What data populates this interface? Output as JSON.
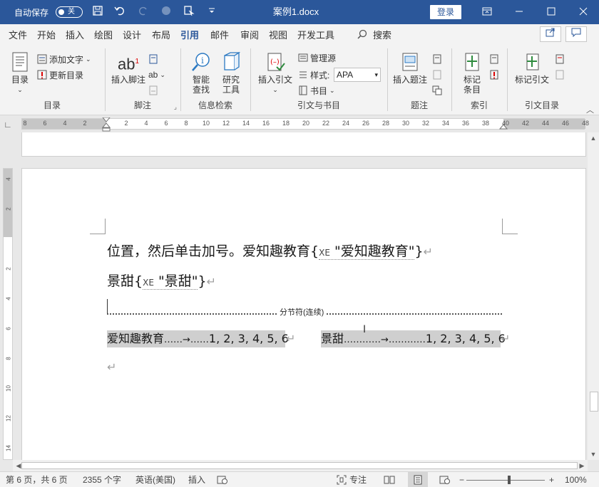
{
  "titlebar": {
    "autosave_label": "自动保存",
    "autosave_state": "关",
    "doc_title": "案例1.docx",
    "login": "登录",
    "icons": [
      "save-icon",
      "undo-icon",
      "redo-icon",
      "circle-icon",
      "touch-mode-icon",
      "customize-qat-icon"
    ]
  },
  "menu": {
    "tabs": [
      "文件",
      "开始",
      "插入",
      "绘图",
      "设计",
      "布局",
      "引用",
      "邮件",
      "审阅",
      "视图",
      "开发工具"
    ],
    "active": "引用",
    "search": "搜索"
  },
  "ribbon": {
    "toc": {
      "btn": "目录",
      "add_text": "添加文字",
      "update": "更新目录",
      "label": "目录"
    },
    "footnote": {
      "insert": "插入脚注",
      "label": "脚注",
      "icon_text": "ab",
      "icon_sup": "1",
      "endnote_icon": "ab"
    },
    "research": {
      "smart_lookup_1": "智能",
      "smart_lookup_2": "查找",
      "researcher_1": "研究",
      "researcher_2": "工具",
      "label": "信息检索"
    },
    "citations": {
      "insert": "插入引文",
      "manage": "管理源",
      "style_label": "样式:",
      "style_value": "APA",
      "bibliography": "书目",
      "label": "引文与书目"
    },
    "captions": {
      "insert": "插入题注",
      "label": "题注"
    },
    "index": {
      "mark_1": "标记",
      "mark_2": "条目",
      "label": "索引"
    },
    "authorities": {
      "mark": "标记引文",
      "label": "引文目录"
    }
  },
  "ruler": {
    "ticks": [
      "8",
      "6",
      "4",
      "2",
      "2",
      "4",
      "6",
      "8",
      "10",
      "12",
      "14",
      "16",
      "18",
      "20",
      "22",
      "24",
      "26",
      "28",
      "30",
      "32",
      "34",
      "36",
      "38",
      "40",
      "42",
      "44",
      "46",
      "48"
    ],
    "vticks": [
      "4",
      "2",
      "2",
      "4",
      "6",
      "8",
      "10",
      "12",
      "14"
    ]
  },
  "document": {
    "line1_text": "位置，然后单击加号。爱知趣教育",
    "line1_field_open": "{",
    "line1_xe": "XE",
    "line1_field_value": "\"爱知趣教育\"",
    "line1_field_close": "}",
    "line2_text": "景甜",
    "line2_field_open": "{",
    "line2_xe": "XE",
    "line2_field_value": "\"景甜\"",
    "line2_field_close": "}",
    "para_mark": "↵",
    "section_break": "分节符(连续)",
    "index_entries": [
      {
        "term": "爱知趣教育",
        "leader": "……→……",
        "pages": "1, 2, 3, 4, 5, 6"
      },
      {
        "term": "景甜",
        "leader": "…………→…………",
        "pages": "1, 2, 3, 4, 5, 6"
      }
    ]
  },
  "statusbar": {
    "page": "第 6 页，共 6 页",
    "words": "2355 个字",
    "language": "英语(美国)",
    "mode": "插入",
    "focus": "专注",
    "zoom": "100%"
  }
}
